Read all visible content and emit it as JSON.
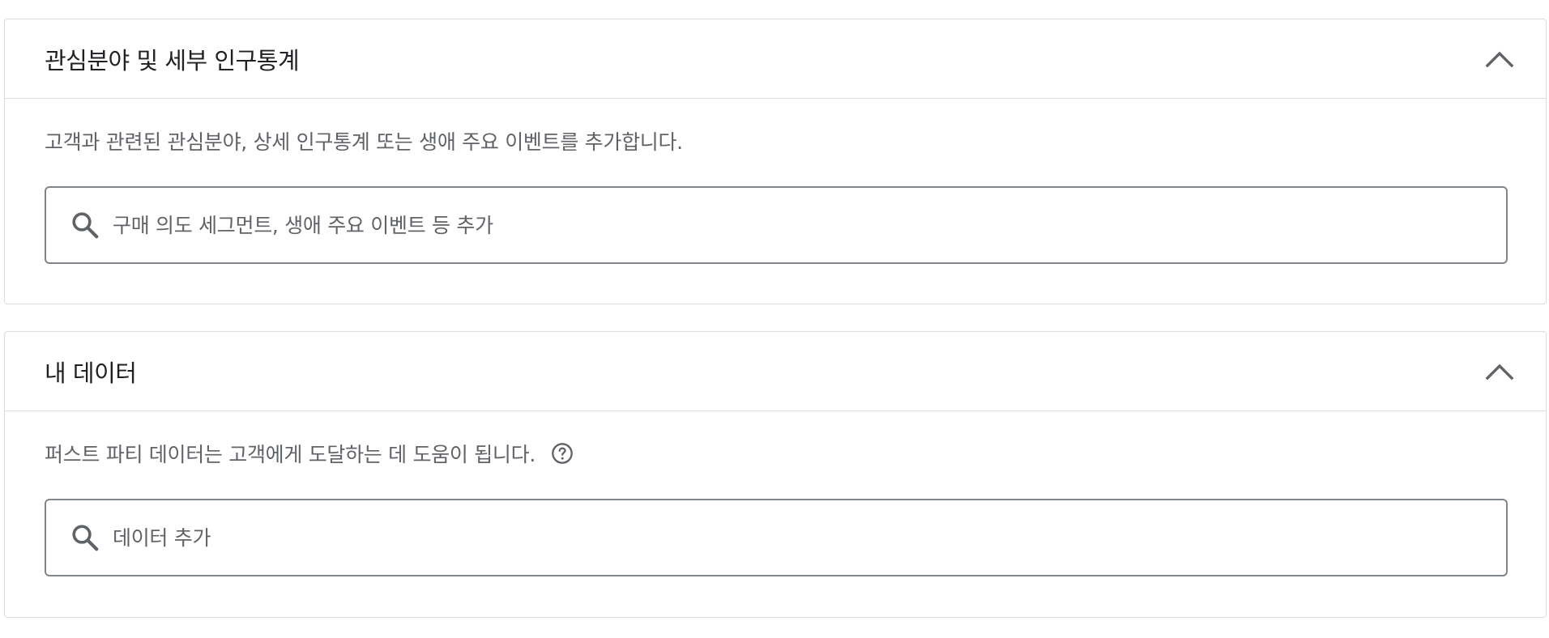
{
  "sections": [
    {
      "title": "관심분야 및 세부 인구통계",
      "description": "고객과 관련된 관심분야, 상세 인구통계 또는 생애 주요 이벤트를 추가합니다.",
      "search_placeholder": "구매 의도 세그먼트, 생애 주요 이벤트 등 추가",
      "search_value": "",
      "expanded": true,
      "collapse_icon": "chevron-up-icon",
      "search_icon": "search-icon"
    },
    {
      "title": "내 데이터",
      "description": "퍼스트 파티 데이터는 고객에게 도달하는 데 도움이 됩니다.",
      "help_icon": "help-circle-icon",
      "search_placeholder": "데이터 추가",
      "search_value": "",
      "expanded": true,
      "collapse_icon": "chevron-up-icon",
      "search_icon": "search-icon"
    }
  ],
  "colors": {
    "border": "#dadce0",
    "input_border": "#80868b",
    "title_text": "#202124",
    "secondary_text": "#5f6368",
    "icon": "#5f6368"
  }
}
